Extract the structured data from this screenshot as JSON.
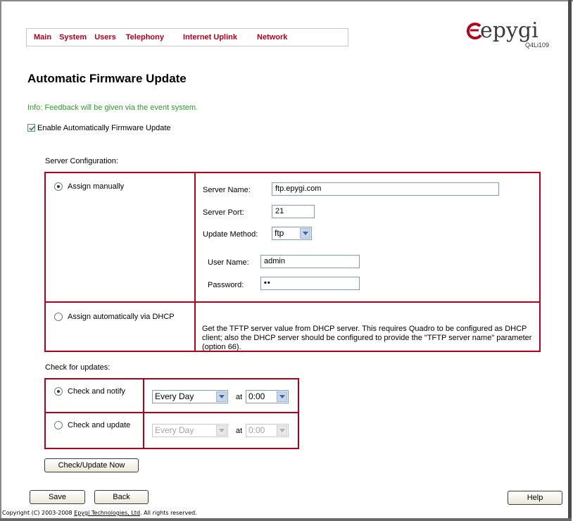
{
  "nav": {
    "items": [
      "Main",
      "System",
      "Users",
      "Telephony",
      "Internet Uplink",
      "Network"
    ]
  },
  "logo": {
    "brand": "epygi",
    "model": "Q4Li109",
    "brand_color": "#b3001b"
  },
  "page": {
    "title": "Automatic Firmware Update",
    "info": "Info: Feedback will be given via the event system.",
    "enable_label": "Enable Automatically Firmware Update",
    "enable_checked": true
  },
  "server": {
    "section_label": "Server Configuration:",
    "manual": {
      "label": "Assign manually",
      "selected": true,
      "server_name_label": "Server Name:",
      "server_name_value": "ftp.epygi.com",
      "server_port_label": "Server Port:",
      "server_port_value": "21",
      "update_method_label": "Update Method:",
      "update_method_value": "ftp",
      "user_name_label": "User Name:",
      "user_name_value": "admin",
      "password_label": "Password:",
      "password_value": "••"
    },
    "dhcp": {
      "label": "Assign automatically via DHCP",
      "selected": false,
      "description": "Get the TFTP server value from DHCP server. This requires Quadro to be configured as DHCP client; also the DHCP server should be configured to provide the \"TFTP server name\" parameter (option 66)."
    }
  },
  "updates": {
    "section_label": "Check for updates:",
    "notify": {
      "label": "Check and notify",
      "selected": true,
      "frequency": "Every Day",
      "at_label": "at",
      "time": "0:00"
    },
    "update": {
      "label": "Check and update",
      "selected": false,
      "frequency": "Every Day",
      "at_label": "at",
      "time": "0:00"
    },
    "check_now_label": "Check/Update Now"
  },
  "buttons": {
    "save": "Save",
    "back": "Back",
    "help": "Help"
  },
  "footer": {
    "prefix": "Copyright (C) 2003-2008 ",
    "link": "Epygi Technologies, Ltd",
    "suffix": ". All rights reserved."
  }
}
